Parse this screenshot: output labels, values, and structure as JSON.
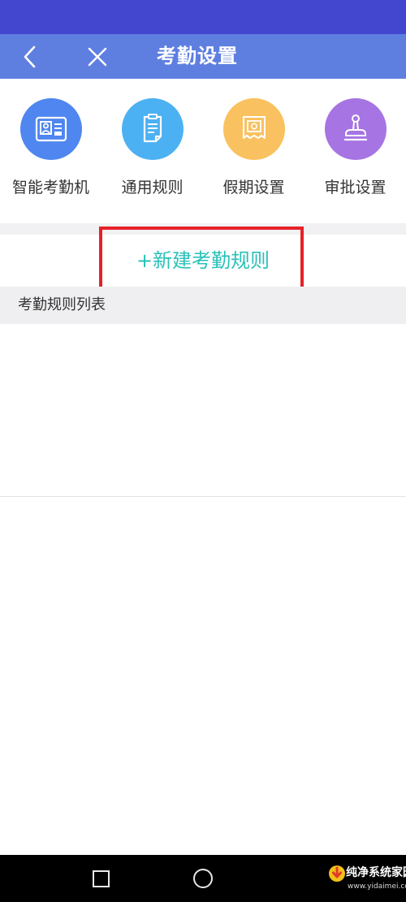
{
  "nav": {
    "title": "考勤设置",
    "back_icon": "chevron-left-icon",
    "close_icon": "close-icon"
  },
  "features": [
    {
      "label": "智能考勤机",
      "icon": "attendance-machine-icon",
      "color": "#4f86ef"
    },
    {
      "label": "通用规则",
      "icon": "clipboard-icon",
      "color": "#4cb1f2"
    },
    {
      "label": "假期设置",
      "icon": "holiday-calendar-icon",
      "color": "#f9c15f"
    },
    {
      "label": "审批设置",
      "icon": "stamp-icon",
      "color": "#a674e3"
    }
  ],
  "new_rule": {
    "label": "+新建考勤规则",
    "color": "#29c1b8",
    "highlight_color": "#e62129"
  },
  "rules_list": {
    "header": "考勤规则列表",
    "items": []
  },
  "system_nav": {
    "recent_icon": "square-icon",
    "home_icon": "circle-icon"
  },
  "watermark": {
    "text": "纯净系统家园",
    "subtext": "www.yidaimei.com"
  },
  "colors": {
    "status_bar": "#4347cf",
    "nav_bar": "#5f7fe0"
  }
}
